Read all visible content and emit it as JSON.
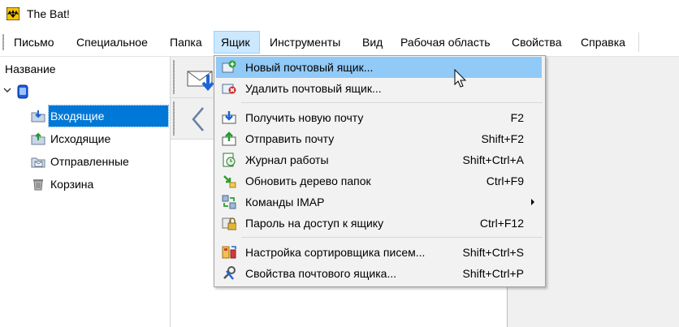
{
  "window": {
    "title": "The Bat!"
  },
  "menubar": {
    "items": [
      "Письмо",
      "Специальное",
      "Папка",
      "Ящик",
      "Инструменты",
      "Вид",
      "Рабочая область",
      "Свойства",
      "Справка"
    ]
  },
  "folders": {
    "column_header": "Название",
    "items": [
      "Входящие",
      "Исходящие",
      "Отправленные",
      "Корзина"
    ]
  },
  "mailbox_menu": {
    "items": [
      {
        "label": "Новый почтовый ящик...",
        "shortcut": "",
        "icon": "new-mailbox-icon"
      },
      {
        "label": "Удалить почтовый ящик...",
        "shortcut": "",
        "icon": "delete-mailbox-icon"
      },
      {
        "label": "Получить новую почту",
        "shortcut": "F2",
        "icon": "get-mail-icon"
      },
      {
        "label": "Отправить почту",
        "shortcut": "Shift+F2",
        "icon": "send-mail-icon"
      },
      {
        "label": "Журнал работы",
        "shortcut": "Shift+Ctrl+A",
        "icon": "log-icon"
      },
      {
        "label": "Обновить дерево папок",
        "shortcut": "Ctrl+F9",
        "icon": "refresh-tree-icon"
      },
      {
        "label": "Команды IMAP",
        "shortcut": "",
        "icon": "imap-icon"
      },
      {
        "label": "Пароль на доступ к ящику",
        "shortcut": "Ctrl+F12",
        "icon": "lock-icon"
      },
      {
        "label": "Настройка сортировщика писем...",
        "shortcut": "Shift+Ctrl+S",
        "icon": "sorter-icon"
      },
      {
        "label": "Свойства почтового ящика...",
        "shortcut": "Shift+Ctrl+P",
        "icon": "properties-icon"
      }
    ]
  },
  "colors": {
    "selection": "#0078d7",
    "menu_hover": "#91c9f7",
    "menubar_open": "#cce8ff",
    "menu_bg": "#f2f2f2"
  }
}
